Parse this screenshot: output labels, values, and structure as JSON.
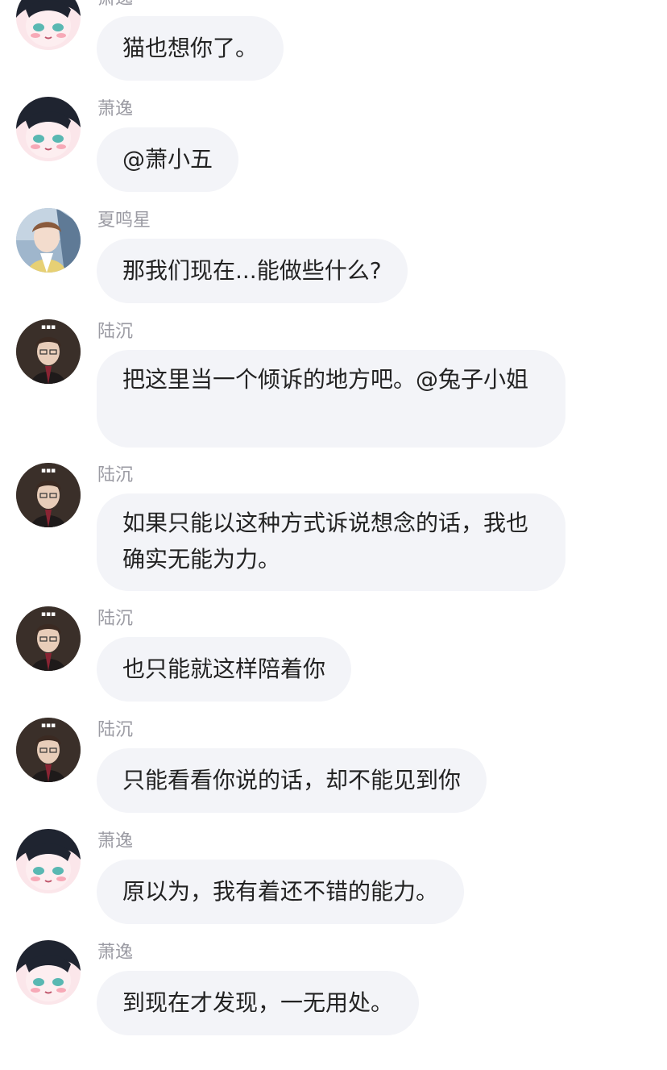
{
  "messages": [
    {
      "sender": "萧逸",
      "avatar": "xiaoyi-avatar",
      "text": "猫也想你了。"
    },
    {
      "sender": "萧逸",
      "avatar": "xiaoyi-avatar",
      "text": "@萧小五"
    },
    {
      "sender": "夏鸣星",
      "avatar": "xiamingxing-avatar",
      "text": "那我们现在...能做些什么?"
    },
    {
      "sender": "陆沉",
      "avatar": "luchen-avatar",
      "text": "把这里当一个倾诉的地方吧。@兔子小姐"
    },
    {
      "sender": "陆沉",
      "avatar": "luchen-avatar",
      "text": "如果只能以这种方式诉说想念的话，我也确实无能为力。"
    },
    {
      "sender": "陆沉",
      "avatar": "luchen-avatar",
      "text": "也只能就这样陪着你"
    },
    {
      "sender": "陆沉",
      "avatar": "luchen-avatar",
      "text": "只能看看你说的话，却不能见到你"
    },
    {
      "sender": "萧逸",
      "avatar": "xiaoyi-avatar",
      "text": "原以为，我有着还不错的能力。"
    },
    {
      "sender": "萧逸",
      "avatar": "xiaoyi-avatar",
      "text": "到现在才发现，一无用处。"
    }
  ],
  "colors": {
    "bubble": "#f3f4f8",
    "sender": "#9b9ba3",
    "text": "#222222"
  }
}
